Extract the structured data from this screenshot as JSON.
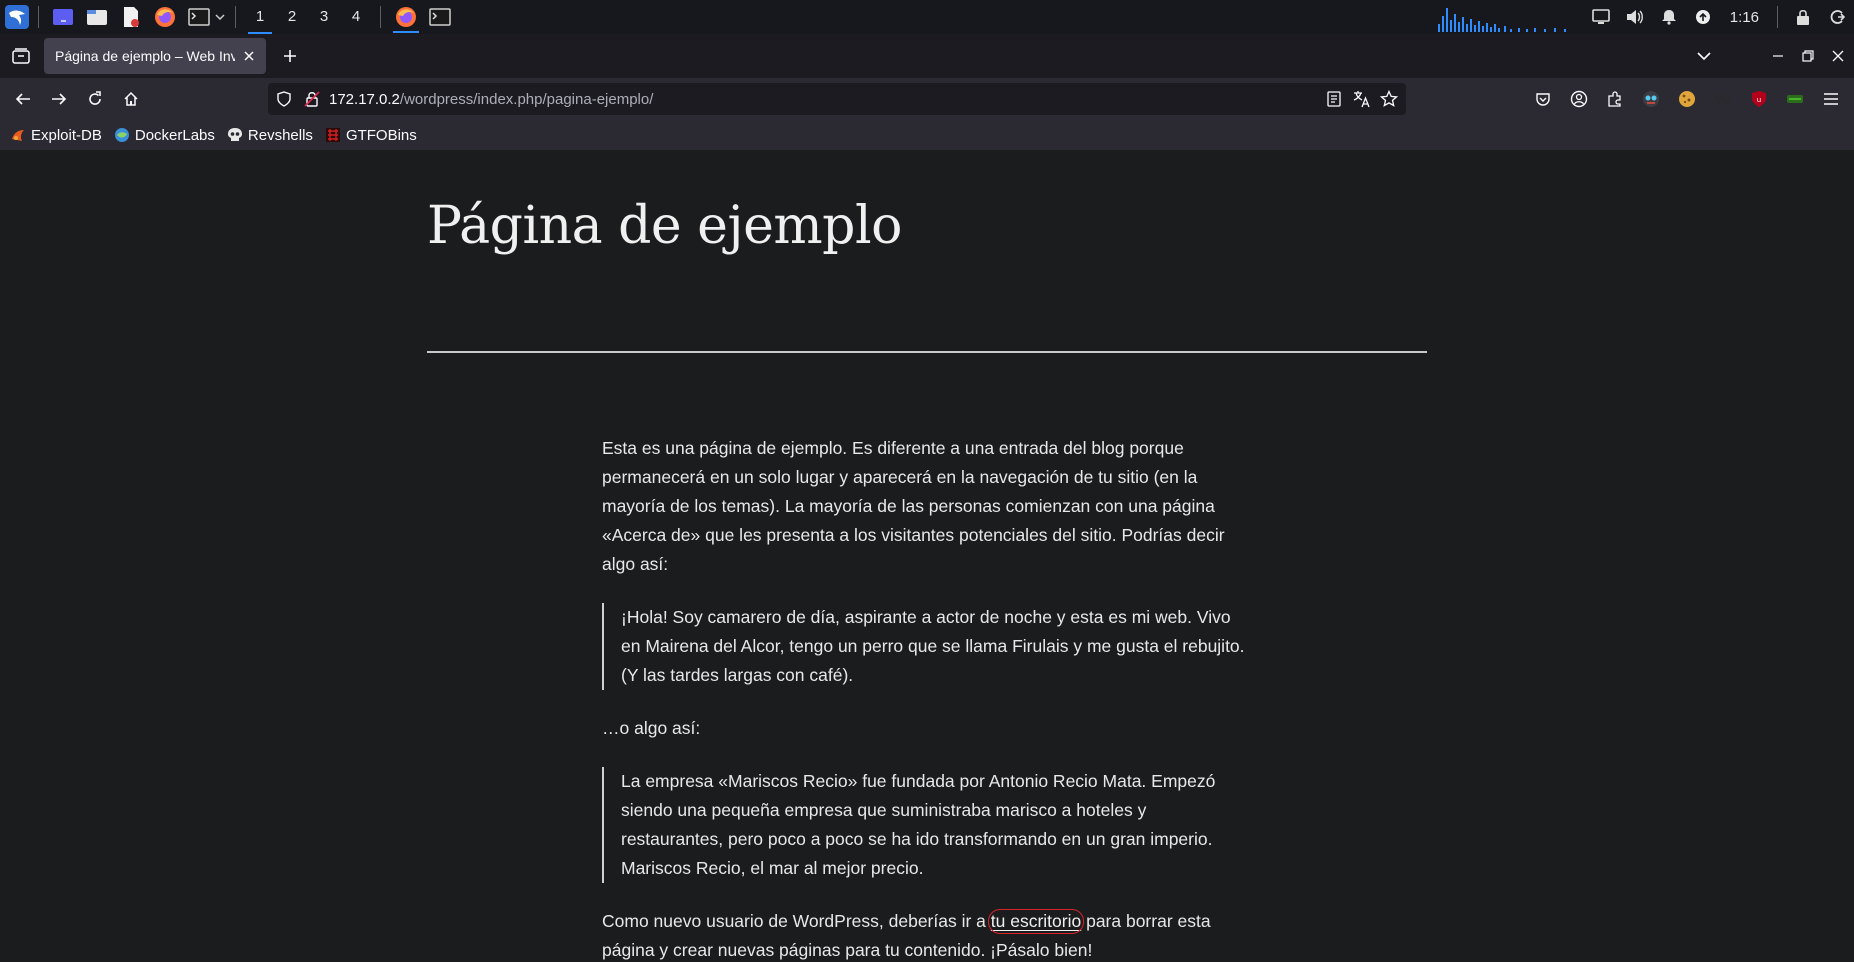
{
  "taskbar": {
    "workspaces": [
      "1",
      "2",
      "3",
      "4"
    ],
    "active_workspace": "1",
    "clock": "1:16",
    "icons": [
      "kali-menu-icon",
      "desktop-icon",
      "file-manager-icon",
      "text-editor-icon",
      "firefox-icon",
      "terminal-icon"
    ]
  },
  "browser": {
    "tab_title": "Página de ejemplo – Web Inv",
    "url_host": "172.17.0.2",
    "url_path": "/wordpress/index.php/pagina-ejemplo/",
    "bookmarks": [
      {
        "label": "Exploit-DB",
        "icon": "exploitdb-icon"
      },
      {
        "label": "DockerLabs",
        "icon": "dockerlabs-icon"
      },
      {
        "label": "Revshells",
        "icon": "skull-icon"
      },
      {
        "label": "GTFOBins",
        "icon": "gtfobins-icon"
      }
    ]
  },
  "colors": {
    "accent": "#2f8cff",
    "annotation": "#d6242a",
    "page_bg": "#1b1c1e"
  },
  "page": {
    "title": "Página de ejemplo",
    "intro": "Esta es una página de ejemplo. Es diferente a una entrada del blog porque permanecerá en un solo lugar y aparecerá en la navegación de tu sitio (en la mayoría de los temas). La mayoría de las personas comienzan con una página «Acerca de» que les presenta a los visitantes potenciales del sitio. Podrías decir algo así:",
    "quote1": "¡Hola! Soy camarero de día, aspirante a actor de noche y esta es mi web. Vivo en Mairena del Alcor, tengo un perro que se llama Firulais y me gusta el rebujito. (Y las tardes largas con café).",
    "middle": "…o algo así:",
    "quote2": "La empresa «Mariscos Recio» fue fundada por Antonio Recio Mata. Empezó siendo una pequeña empresa que suministraba marisco a hoteles y restaurantes, pero poco a poco se ha ido transformando en un gran imperio. Mariscos Recio, el mar al mejor precio.",
    "final_before": "Como nuevo usuario de WordPress, deberías ir a ",
    "final_link": "tu escritorio",
    "final_after": " para borrar esta página y crear nuevas páginas para tu contenido. ¡Pásalo bien!"
  }
}
